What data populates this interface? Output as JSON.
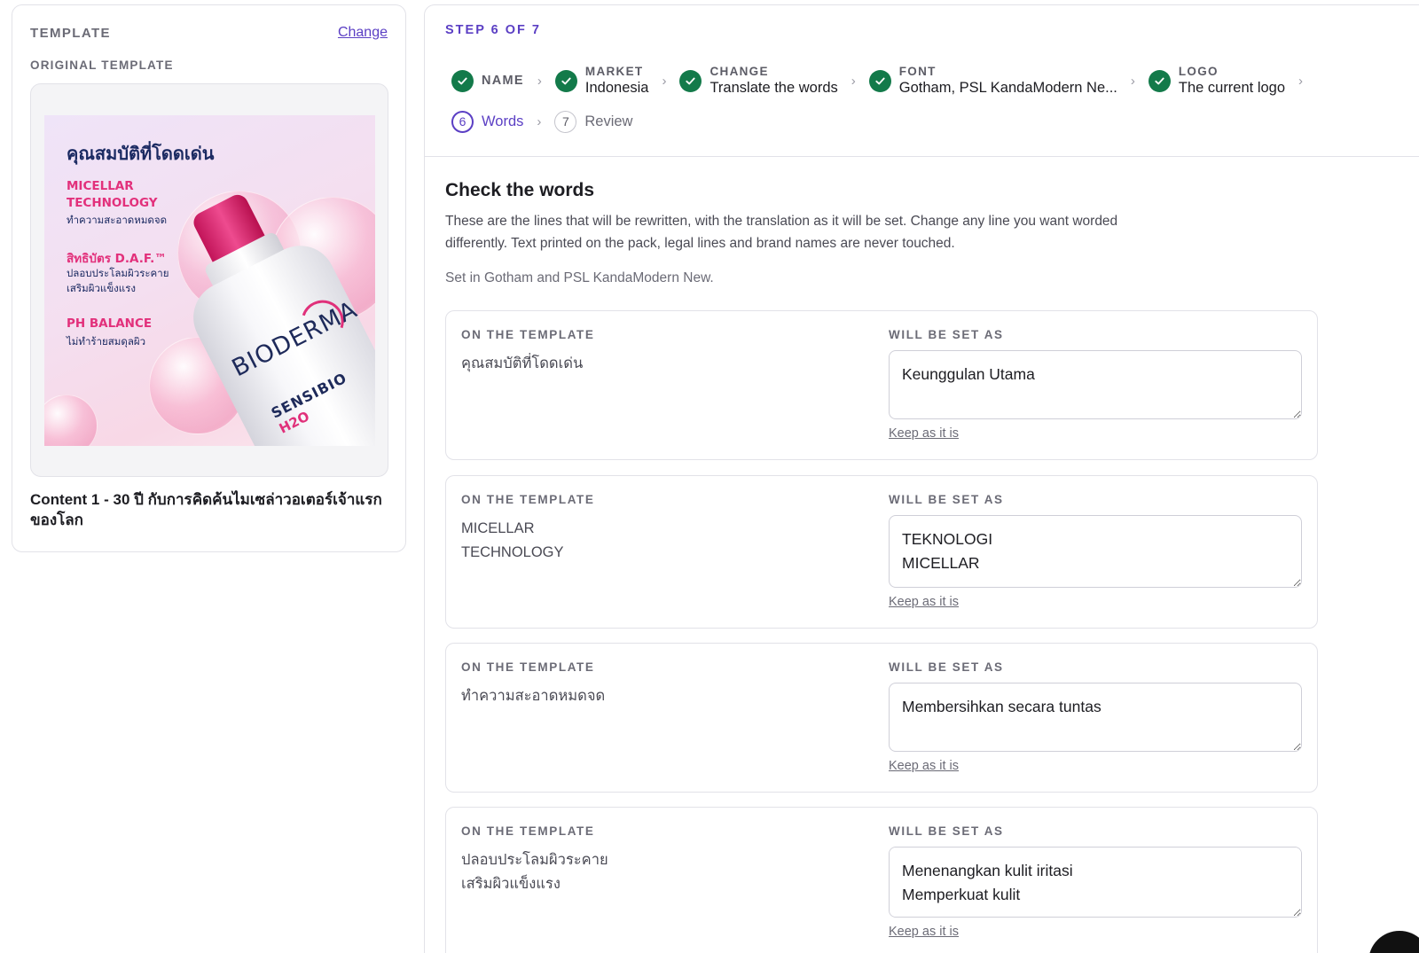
{
  "template_panel": {
    "title": "TEMPLATE",
    "change_label": "Change",
    "original_label": "ORIGINAL TEMPLATE",
    "caption": "Content 1 - 30 ปี กับการคิดค้นไมเซล่าวอเตอร์เจ้าแรกของโลก",
    "thumbnail": {
      "headline": "คุณสมบัติที่โดดเด่น",
      "line1_a": "MICELLAR",
      "line1_b": "TECHNOLOGY",
      "line1_sub": "ทำความสะอาดหมดจด",
      "line2": "สิทธิบัตร D.A.F.™",
      "line2_sub_a": "ปลอบประโลมผิวระคาย",
      "line2_sub_b": "เสริมผิวแข็งแรง",
      "line3": "PH BALANCE",
      "line3_sub": "ไม่ทำร้ายสมดุลผิว",
      "bottle_brand": "BIODERMA",
      "bottle_product": "SENSIBIO",
      "bottle_h2o": "H2O"
    }
  },
  "wizard": {
    "step_label": "STEP 6 OF 7",
    "steps": [
      {
        "title": "NAME",
        "value": ""
      },
      {
        "title": "MARKET",
        "value": "Indonesia"
      },
      {
        "title": "CHANGE",
        "value": "Translate the words"
      },
      {
        "title": "FONT",
        "value": "Gotham, PSL KandaModern Ne..."
      },
      {
        "title": "LOGO",
        "value": "The current logo"
      }
    ],
    "current_step": {
      "number": "6",
      "label": "Words"
    },
    "next_step": {
      "number": "7",
      "label": "Review"
    }
  },
  "section": {
    "title": "Check the words",
    "description": "These are the lines that will be rewritten, with the translation as it will be set. Change any line you want worded differently. Text printed on the pack, legal lines and brand names are never touched.",
    "font_note": "Set in Gotham and PSL KandaModern New."
  },
  "rows_labels": {
    "original": "ON THE TEMPLATE",
    "translated": "WILL BE SET AS",
    "keep": "Keep as it is"
  },
  "rows": [
    {
      "original": "คุณสมบัติที่โดดเด่น",
      "translated": "Keunggulan Utama"
    },
    {
      "original": "MICELLAR\nTECHNOLOGY",
      "translated": "TEKNOLOGI\nMICELLAR"
    },
    {
      "original": "ทำความสะอาดหมดจด",
      "translated": "Membersihkan secara tuntas"
    },
    {
      "original": "ปลอบประโลมผิวระคาย\nเสริมผิวแข็งแรง",
      "translated": "Menenangkan kulit iritasi\nMemperkuat kulit"
    }
  ],
  "colors": {
    "accent": "#5b3fc4",
    "success": "#137a4a",
    "brand_pink": "#e2307b"
  },
  "icons": {
    "step_done": "check-icon",
    "separator": "chevron-right-icon"
  }
}
